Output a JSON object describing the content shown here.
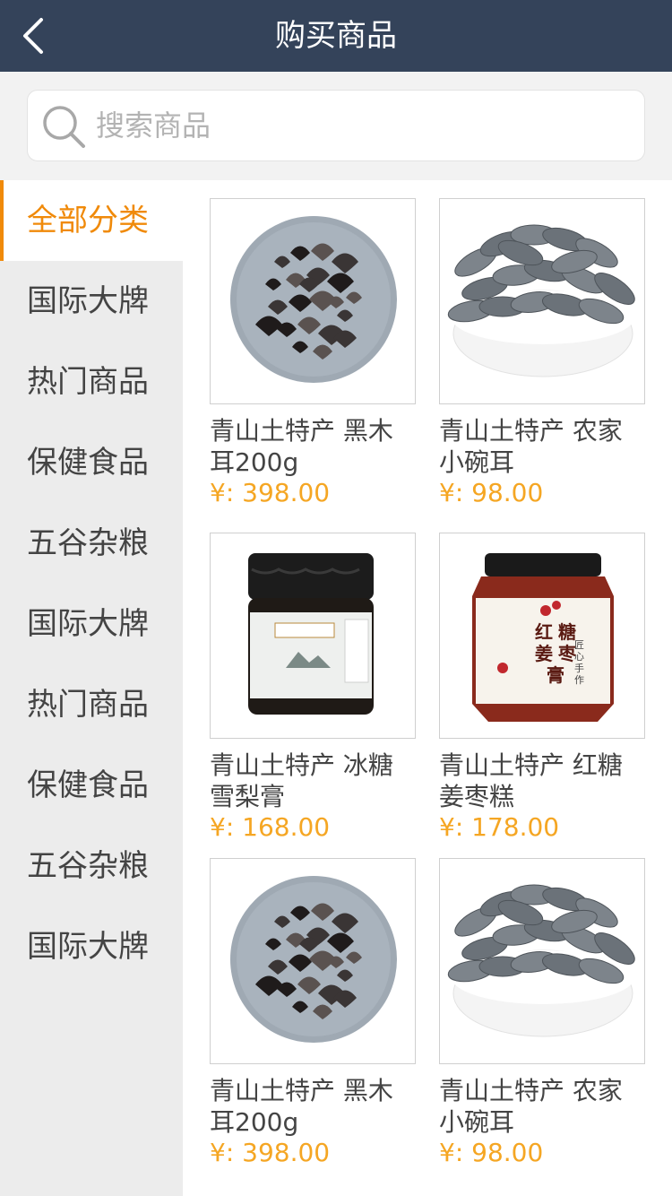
{
  "header": {
    "title": "购买商品",
    "back_icon": "chevron-left-icon"
  },
  "search": {
    "placeholder": "搜索商品",
    "icon": "search-icon"
  },
  "sidebar": {
    "active_color": "#f08a0a",
    "items": [
      {
        "label": "全部分类",
        "active": true
      },
      {
        "label": "国际大牌"
      },
      {
        "label": "热门商品"
      },
      {
        "label": "保健食品"
      },
      {
        "label": "五谷杂粮"
      },
      {
        "label": "国际大牌"
      },
      {
        "label": "热门商品"
      },
      {
        "label": "保健食品"
      },
      {
        "label": "五谷杂粮"
      },
      {
        "label": "国际大牌"
      }
    ]
  },
  "products": [
    {
      "name": "青山土特产 黑木耳200g",
      "price": "¥: 398.00",
      "image": "black-fungus-plate"
    },
    {
      "name": "青山土特产 农家小碗耳",
      "price": "¥: 98.00",
      "image": "small-bowl-fungus"
    },
    {
      "name": "青山土特产 冰糖雪梨膏",
      "price": "¥: 168.00",
      "image": "pear-paste-jar"
    },
    {
      "name": "青山土特产 红糖姜枣糕",
      "price": "¥: 178.00",
      "image": "ginger-date-jar"
    },
    {
      "name": "青山土特产 黑木耳200g",
      "price": "¥: 398.00",
      "image": "black-fungus-plate"
    },
    {
      "name": "青山土特产 农家小碗耳",
      "price": "¥: 98.00",
      "image": "small-bowl-fungus"
    }
  ],
  "jar_labels": {
    "ginger": [
      "红",
      "糖",
      "姜",
      "枣",
      "膏"
    ],
    "ginger_sub": "匠心手作"
  },
  "colors": {
    "header_bg": "#34435a",
    "price": "#f5a623"
  }
}
